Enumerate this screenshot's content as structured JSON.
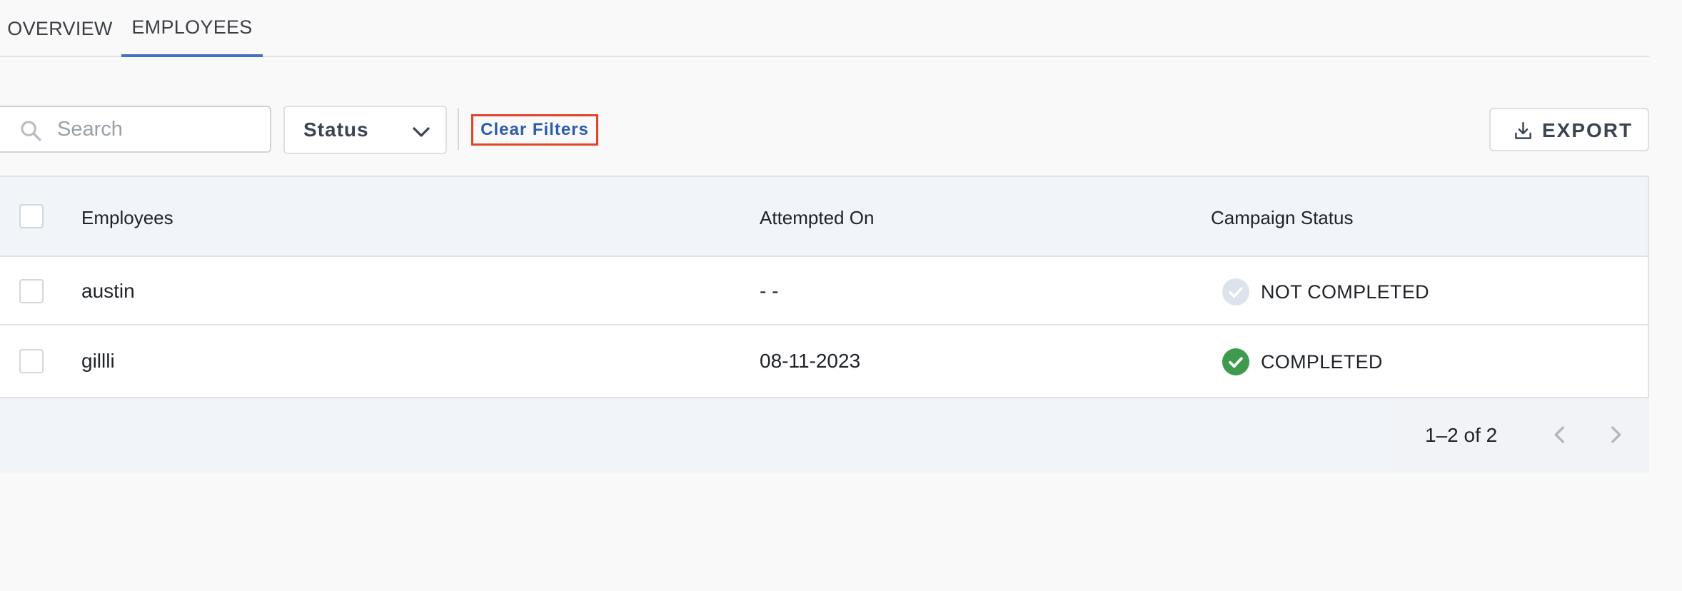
{
  "tabs": [
    {
      "label": "OVERVIEW",
      "active": false
    },
    {
      "label": "EMPLOYEES",
      "active": true
    }
  ],
  "toolbar": {
    "search_placeholder": "Search",
    "search_value": "",
    "status_label": "Status",
    "clear_filters_label": "Clear Filters",
    "export_label": "EXPORT"
  },
  "table": {
    "columns": [
      "Employees",
      "Attempted On",
      "Campaign Status"
    ],
    "rows": [
      {
        "employee": "austin",
        "attempted_on": "- -",
        "status": "NOT COMPLETED",
        "status_icon": "check-circle-grey-icon"
      },
      {
        "employee": "gillli",
        "attempted_on": "08-11-2023",
        "status": "COMPLETED",
        "status_icon": "check-circle-green-icon"
      }
    ]
  },
  "pagination": {
    "range_text": "1–2 of 2"
  },
  "colors": {
    "accent": "#3d72c6",
    "clear_filters_text": "#2b5cad",
    "highlight_border": "#e0452b",
    "completed": "#3f9a4e",
    "not_completed": "#dde3ec"
  }
}
